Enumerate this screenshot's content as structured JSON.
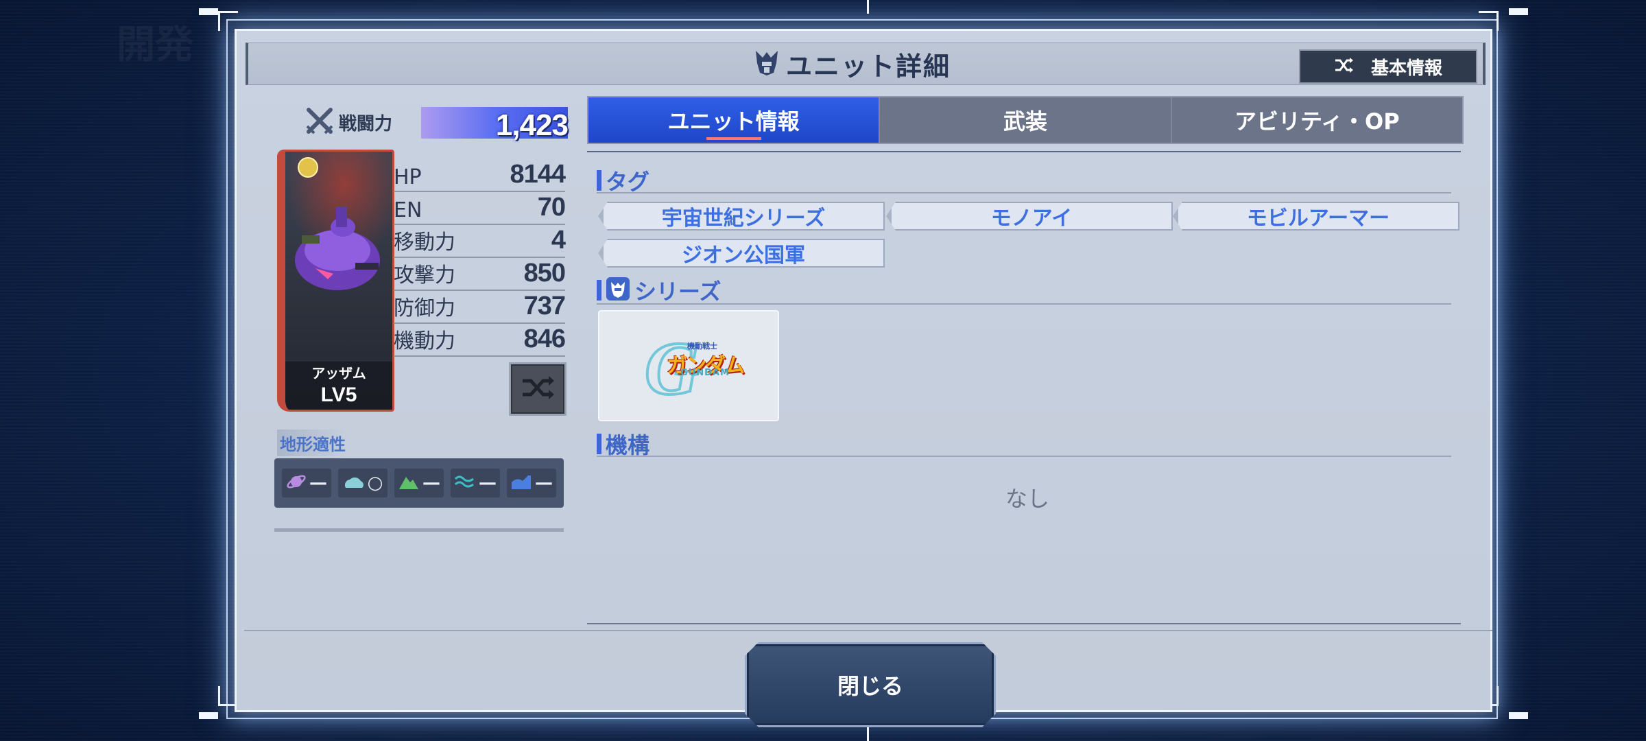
{
  "background": {
    "ghost_text": "開発"
  },
  "header": {
    "title": "ユニット詳細",
    "toggle_label": "基本情報"
  },
  "power": {
    "label": "戦闘力",
    "value": "1,423"
  },
  "unit": {
    "name": "アッザム",
    "level": "LV5"
  },
  "stats": [
    {
      "label": "HP",
      "value": "8144"
    },
    {
      "label": "EN",
      "value": "70"
    },
    {
      "label": "移動力",
      "value": "4"
    },
    {
      "label": "攻撃力",
      "value": "850"
    },
    {
      "label": "防御力",
      "value": "737"
    },
    {
      "label": "機動力",
      "value": "846"
    }
  ],
  "terrain": {
    "title": "地形適性",
    "items": [
      {
        "icon": "space-icon",
        "grade": "—"
      },
      {
        "icon": "air-icon",
        "grade": "○"
      },
      {
        "icon": "ground-icon",
        "grade": "—"
      },
      {
        "icon": "water-surface-icon",
        "grade": "—"
      },
      {
        "icon": "underwater-icon",
        "grade": "—"
      }
    ]
  },
  "tabs": [
    {
      "label": "ユニット情報",
      "active": true
    },
    {
      "label": "武装",
      "active": false
    },
    {
      "label": "アビリティ・OP",
      "active": false
    }
  ],
  "sections": {
    "tags_title": "タグ",
    "tags": [
      "宇宙世紀シリーズ",
      "モノアイ",
      "モビルアーマー",
      "ジオン公国軍"
    ],
    "series_title": "シリーズ",
    "series_logo": {
      "small": "機動戦士",
      "main": "ガンダム",
      "sub": "GUNDAM",
      "letter": "G"
    },
    "mechanism_title": "機構",
    "mechanism_empty": "なし"
  },
  "footer": {
    "close_label": "閉じる"
  },
  "colors": {
    "accent": "#2f5fe6",
    "tag_text": "#3d6fe0",
    "panel": "#c9d2e0",
    "frame_glow": "#8cbeff"
  }
}
